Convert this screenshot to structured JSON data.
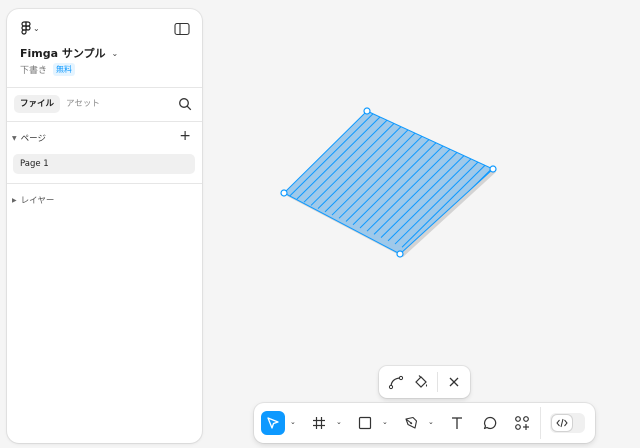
{
  "app": {
    "file_title": "Fimga サンプル",
    "draft_label": "下書き",
    "plan_badge": "無料"
  },
  "tabs": [
    {
      "label": "ファイル",
      "active": true
    },
    {
      "label": "アセット",
      "active": false
    }
  ],
  "pages": {
    "header": "ページ",
    "items": [
      "Page 1"
    ]
  },
  "layers": {
    "header": "レイヤー"
  },
  "canvas": {
    "shape_fill_color": "#9fc9ea",
    "hatch_color": "#0d99ff",
    "handle_color": "#0d99ff"
  },
  "edit_toolbar": {
    "icons": [
      "bend-tool-icon",
      "paint-bucket-icon",
      "close-icon"
    ]
  },
  "toolbar": {
    "tools": [
      "move-tool",
      "frame-tool",
      "shape-tool",
      "pen-tool",
      "text-tool",
      "comment-tool",
      "actions-tool"
    ],
    "active_tool": "move-tool",
    "accent_color": "#0d99ff"
  }
}
